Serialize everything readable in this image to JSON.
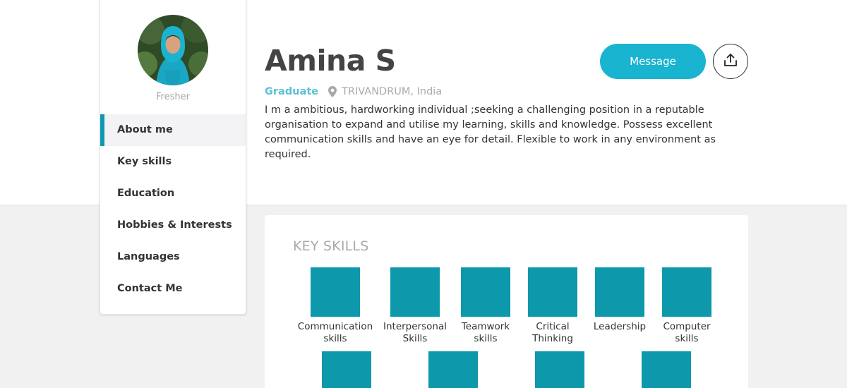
{
  "profile": {
    "name": "Amina S",
    "role_label": "Fresher",
    "status": "Graduate",
    "location": "TRIVANDRUM, India",
    "bio": "I m a ambitious, hardworking individual ;seeking a challenging position in a reputable organisation to expand and utilise my learning, skills and knowledge. Possess excellent communication skills and have an eye for detail. Flexible to work in any environment as required."
  },
  "actions": {
    "message_label": "Message",
    "share_icon": "share-upload-icon"
  },
  "sidebar": {
    "items": [
      {
        "label": "About me",
        "active": true
      },
      {
        "label": "Key skills",
        "active": false
      },
      {
        "label": "Education",
        "active": false
      },
      {
        "label": "Hobbies & Interests",
        "active": false
      },
      {
        "label": "Languages",
        "active": false
      },
      {
        "label": "Contact Me",
        "active": false
      }
    ]
  },
  "skills": {
    "title": "KEY SKILLS",
    "items": [
      {
        "line1": "Communication",
        "line2": "skills"
      },
      {
        "line1": "Interpersonal",
        "line2": "Skills"
      },
      {
        "line1": "Teamwork",
        "line2": "skills"
      },
      {
        "line1": "Critical",
        "line2": "Thinking"
      },
      {
        "line1": "Leadership",
        "line2": ""
      },
      {
        "line1": "Computer",
        "line2": "skills"
      },
      {
        "line1": "",
        "line2": ""
      },
      {
        "line1": "",
        "line2": ""
      },
      {
        "line1": "",
        "line2": ""
      },
      {
        "line1": "",
        "line2": ""
      }
    ]
  },
  "colors": {
    "accent": "#19b4d0",
    "tile": "#0d98ab",
    "status": "#5bc0d4",
    "page_bg": "#f1f1f1"
  }
}
